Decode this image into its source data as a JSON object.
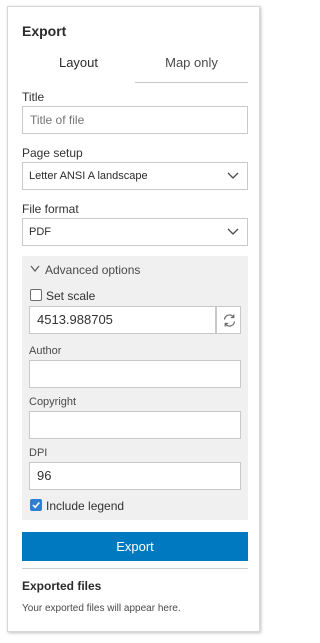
{
  "panel": {
    "title": "Export"
  },
  "tabs": [
    {
      "label": "Layout",
      "active": true
    },
    {
      "label": "Map only",
      "active": false
    }
  ],
  "title_field": {
    "label": "Title",
    "value": "",
    "placeholder": "Title of file"
  },
  "page_setup": {
    "label": "Page setup",
    "selected": "Letter ANSI A landscape"
  },
  "file_format": {
    "label": "File format",
    "selected": "PDF"
  },
  "advanced": {
    "toggle_label": "Advanced options",
    "expanded": true,
    "set_scale": {
      "label": "Set scale",
      "checked": false
    },
    "scale_value": "4513.988705",
    "author": {
      "label": "Author",
      "value": ""
    },
    "copyright": {
      "label": "Copyright",
      "value": ""
    },
    "dpi": {
      "label": "DPI",
      "value": "96"
    },
    "include_legend": {
      "label": "Include legend",
      "checked": true
    }
  },
  "export_button": {
    "label": "Export"
  },
  "exported_files": {
    "title": "Exported files",
    "empty_message": "Your exported files will appear here."
  },
  "colors": {
    "accent": "#0079c1",
    "checkbox": "#2f7fd1",
    "section_bg": "#f0f0f0"
  },
  "icons": {
    "select_chevron": "chevron-down-icon",
    "advanced_toggle": "triangle-down-icon",
    "refresh": "refresh-icon",
    "check": "checkmark-icon"
  }
}
